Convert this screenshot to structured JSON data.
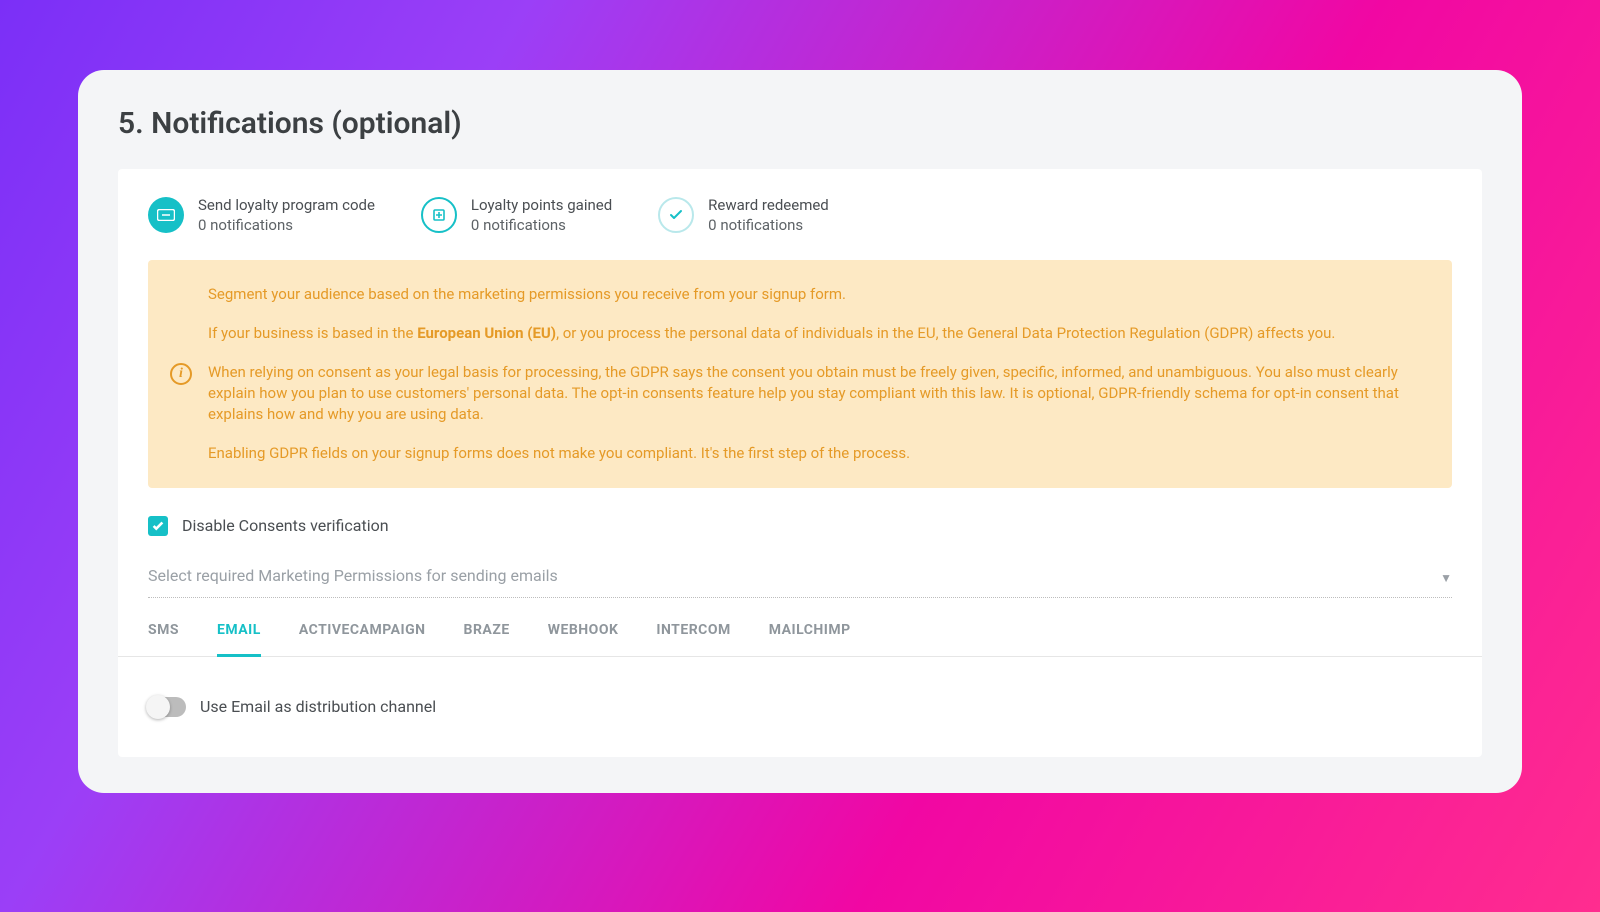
{
  "section": {
    "title": "5. Notifications (optional)"
  },
  "notifications": {
    "items": [
      {
        "title": "Send loyalty program code",
        "sub": "0 notifications"
      },
      {
        "title": "Loyalty points gained",
        "sub": "0 notifications"
      },
      {
        "title": "Reward redeemed",
        "sub": "0 notifications"
      }
    ]
  },
  "alert": {
    "p1": "Segment your audience based on the marketing permissions you receive from your signup form.",
    "p2_pre": "If your business is based in the ",
    "p2_bold": "European Union (EU)",
    "p2_post": ", or you process the personal data of individuals in the EU, the General Data Protection Regulation (GDPR) affects you.",
    "p3": "When relying on consent as your legal basis for processing, the GDPR says the consent you obtain must be freely given, specific, informed, and unambiguous. You also must clearly explain how you plan to use customers' personal data. The opt-in consents feature help you stay compliant with this law. It is optional, GDPR-friendly schema for opt-in consent that explains how and why you are using data.",
    "p4": "Enabling GDPR fields on your signup forms does not make you compliant. It's the first step of the process."
  },
  "consent": {
    "label": "Disable Consents verification",
    "checked": true
  },
  "select": {
    "placeholder": "Select required Marketing Permissions for sending emails"
  },
  "tabs": {
    "items": [
      {
        "label": "SMS",
        "active": false
      },
      {
        "label": "EMAIL",
        "active": true
      },
      {
        "label": "ACTIVECAMPAIGN",
        "active": false
      },
      {
        "label": "BRAZE",
        "active": false
      },
      {
        "label": "WEBHOOK",
        "active": false
      },
      {
        "label": "INTERCOM",
        "active": false
      },
      {
        "label": "MAILCHIMP",
        "active": false
      }
    ]
  },
  "toggle": {
    "label": "Use Email as distribution channel",
    "on": false
  }
}
